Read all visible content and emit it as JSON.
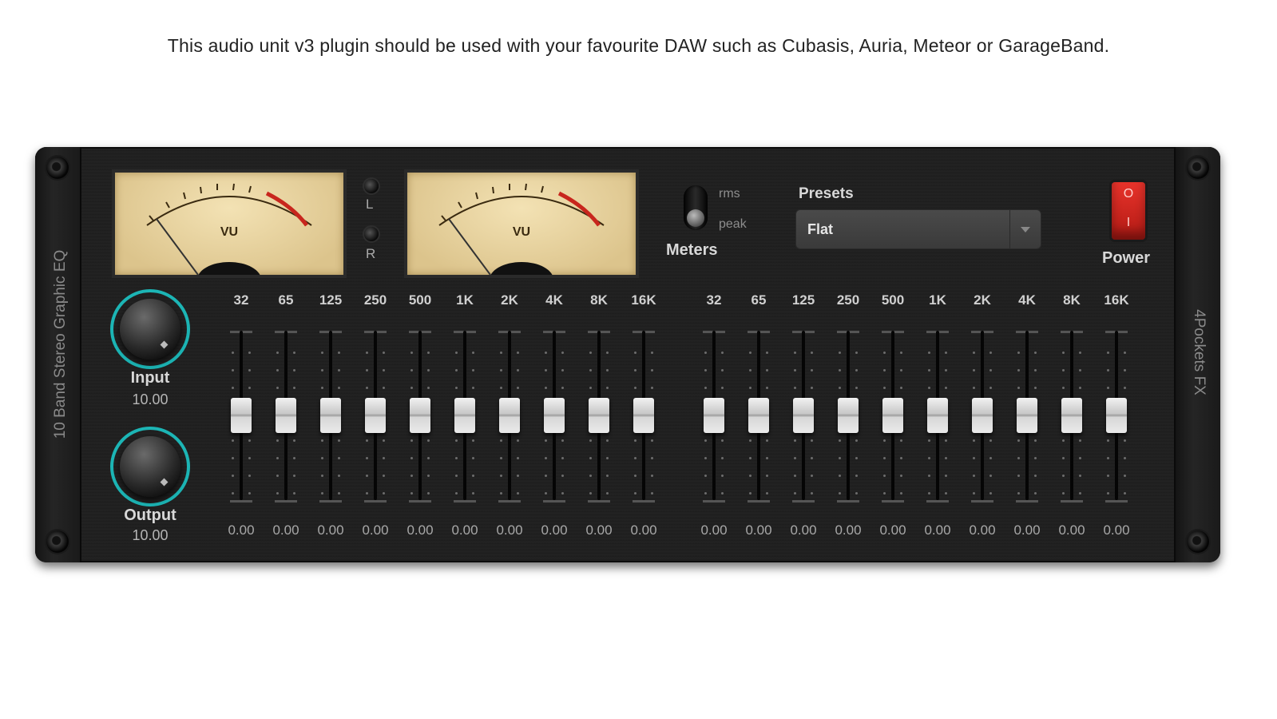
{
  "caption": "This audio unit v3 plugin should be used with your favourite DAW such as Cubasis, Auria, Meteor or GarageBand.",
  "plugin_name": "10 Band Stereo Graphic EQ",
  "brand": "4Pockets FX",
  "vu_meters": [
    {
      "label": "VU",
      "level": 0
    },
    {
      "label": "VU",
      "level": 0
    }
  ],
  "channel_leds": {
    "left": "L",
    "right": "R"
  },
  "meters": {
    "label": "Meters",
    "option_rms": "rms",
    "option_peak": "peak",
    "selected": "peak"
  },
  "presets": {
    "label": "Presets",
    "value": "Flat"
  },
  "power": {
    "label": "Power",
    "on_symbol": "O",
    "off_symbol": "I",
    "color": "#e8332b"
  },
  "knobs": {
    "input": {
      "label": "Input",
      "value": "10.00"
    },
    "output": {
      "label": "Output",
      "value": "10.00"
    },
    "ring_color": "#1cb5b5"
  },
  "eq_left": {
    "bands": [
      "32",
      "65",
      "125",
      "250",
      "500",
      "1K",
      "2K",
      "4K",
      "8K",
      "16K"
    ],
    "values": [
      "0.00",
      "0.00",
      "0.00",
      "0.00",
      "0.00",
      "0.00",
      "0.00",
      "0.00",
      "0.00",
      "0.00"
    ]
  },
  "eq_right": {
    "bands": [
      "32",
      "65",
      "125",
      "250",
      "500",
      "1K",
      "2K",
      "4K",
      "8K",
      "16K"
    ],
    "values": [
      "0.00",
      "0.00",
      "0.00",
      "0.00",
      "0.00",
      "0.00",
      "0.00",
      "0.00",
      "0.00",
      "0.00"
    ]
  }
}
